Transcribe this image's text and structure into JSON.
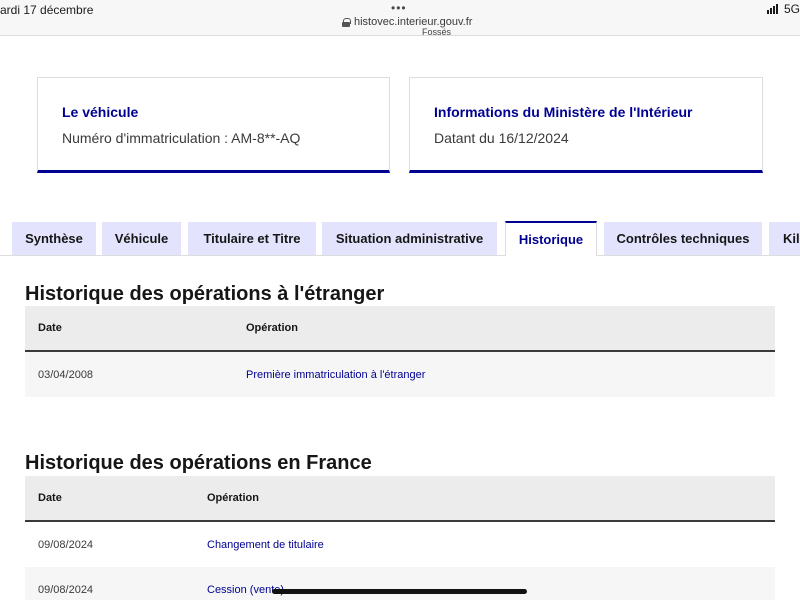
{
  "status_bar": {
    "date": "ardi 17 décembre",
    "url": "histovec.interieur.gouv.fr",
    "network": "5G",
    "peek_text": "Fossés",
    "dots": "•••"
  },
  "cards": {
    "vehicle": {
      "title": "Le véhicule",
      "text": "Numéro d'immatriculation : AM-8**-AQ"
    },
    "ministry": {
      "title": "Informations du Ministère de l'Intérieur",
      "text": "Datant du 16/12/2024"
    }
  },
  "tabs": [
    {
      "label": "Synthèse",
      "active": false
    },
    {
      "label": "Véhicule",
      "active": false
    },
    {
      "label": "Titulaire et Titre",
      "active": false
    },
    {
      "label": "Situation administrative",
      "active": false
    },
    {
      "label": "Historique",
      "active": true
    },
    {
      "label": "Contrôles techniques",
      "active": false
    },
    {
      "label": "Kilo",
      "active": false
    }
  ],
  "foreign_history": {
    "title": "Historique des opérations à l'étranger",
    "columns": [
      "Date",
      "Opération"
    ],
    "rows": [
      {
        "date": "03/04/2008",
        "operation": "Première immatriculation à l'étranger"
      }
    ]
  },
  "france_history": {
    "title": "Historique des opérations en France",
    "columns": [
      "Date",
      "Opération"
    ],
    "rows": [
      {
        "date": "09/08/2024",
        "operation": "Changement de titulaire"
      },
      {
        "date": "09/08/2024",
        "operation": "Cession (vente)"
      }
    ]
  },
  "colors": {
    "accent": "#000091",
    "tab_bg": "#e3e3fd",
    "table_header_bg": "#ececec"
  }
}
